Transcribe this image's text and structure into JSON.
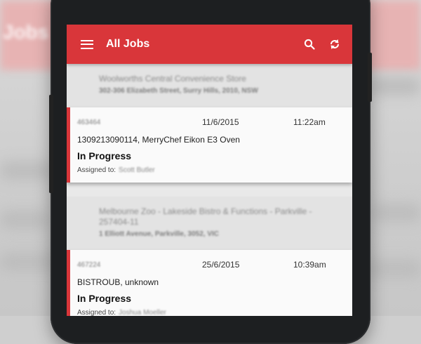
{
  "backdrop": {
    "title_text": "Jobs"
  },
  "app": {
    "title": "All Jobs",
    "icons": {
      "menu": "hamburger-menu-icon",
      "search": "search-icon",
      "sync": "sync-icon"
    }
  },
  "jobs": [
    {
      "site_name": "Woolworths Central Convenience Store",
      "site_address": "302-306 Elizabeth Street, Surry Hills, 2010, NSW",
      "job_id": "463464",
      "date": "11/6/2015",
      "time": "11:22am",
      "equipment": "1309213090114, MerryChef Eikon E3 Oven",
      "status": "In Progress",
      "assigned_label": "Assigned to:",
      "assignee": "Scott Butler"
    },
    {
      "site_name": "Melbourne Zoo - Lakeside Bistro & Functions - Parkville - 257404-11",
      "site_address": "1 Elliott Avenue, Parkville, 3052, VIC",
      "job_id": "467224",
      "date": "25/6/2015",
      "time": "10:39am",
      "equipment": "BISTROUB, unknown",
      "status": "In Progress",
      "assigned_label": "Assigned to:",
      "assignee": "Joshua Moeller"
    }
  ],
  "colors": {
    "accent": "#d9363a",
    "background": "#e9e9e9"
  }
}
